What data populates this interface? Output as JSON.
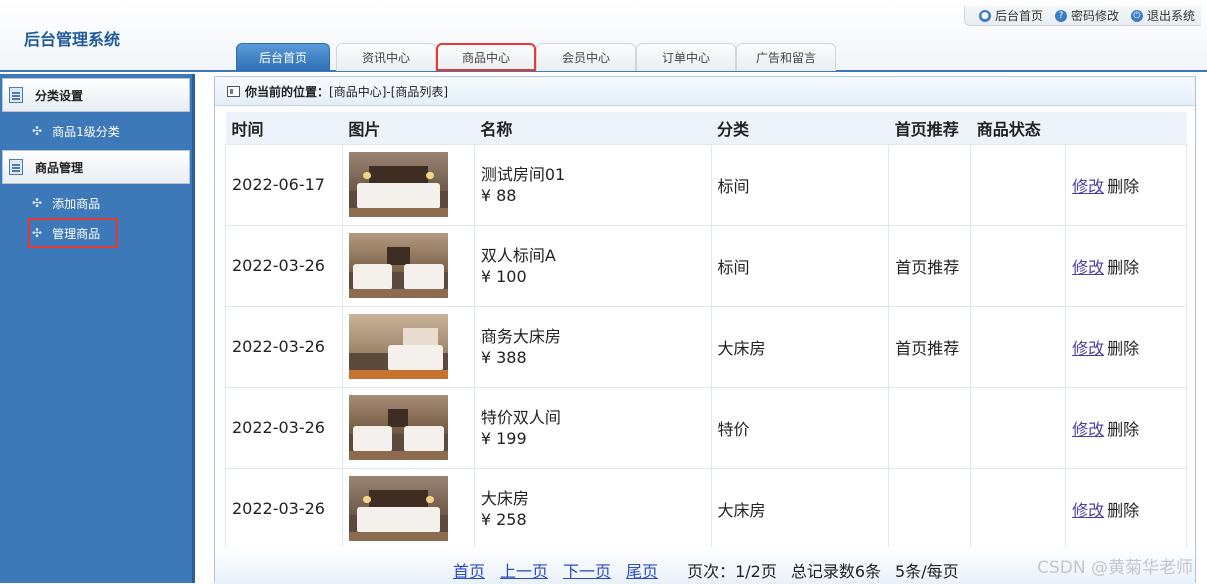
{
  "app": {
    "title": "后台管理系统"
  },
  "top_links": [
    {
      "label": "后台首页",
      "icon": "user-icon"
    },
    {
      "label": "密码修改",
      "icon": "question-icon"
    },
    {
      "label": "退出系统",
      "icon": "power-icon"
    }
  ],
  "tabs": [
    {
      "label": "后台首页",
      "active": true
    },
    {
      "label": "资讯中心"
    },
    {
      "label": "商品中心",
      "highlighted": true
    },
    {
      "label": "会员中心"
    },
    {
      "label": "订单中心"
    },
    {
      "label": "广告和留言"
    }
  ],
  "sidebar": {
    "sections": [
      {
        "title": "分类设置",
        "items": [
          {
            "label": "商品1级分类"
          }
        ]
      },
      {
        "title": "商品管理",
        "items": [
          {
            "label": "添加商品"
          },
          {
            "label": "管理商品",
            "highlighted": true
          }
        ]
      }
    ]
  },
  "breadcrumb": {
    "prefix": "你当前的位置：",
    "path": "[商品中心]-[商品列表]"
  },
  "table": {
    "headers": [
      "时间",
      "图片",
      "名称",
      "分类",
      "首页推荐",
      "商品状态",
      ""
    ],
    "rows": [
      {
        "date": "2022-06-17",
        "name": "测试房间01",
        "price": "¥ 88",
        "category": "标间",
        "recommend": "",
        "status": ""
      },
      {
        "date": "2022-03-26",
        "name": "双人标间A",
        "price": "¥ 100",
        "category": "标间",
        "recommend": "首页推荐",
        "status": ""
      },
      {
        "date": "2022-03-26",
        "name": "商务大床房",
        "price": "¥ 388",
        "category": "大床房",
        "recommend": "首页推荐",
        "status": ""
      },
      {
        "date": "2022-03-26",
        "name": "特价双人间",
        "price": "¥ 199",
        "category": "特价",
        "recommend": "",
        "status": ""
      },
      {
        "date": "2022-03-26",
        "name": "大床房",
        "price": "¥ 258",
        "category": "大床房",
        "recommend": "",
        "status": ""
      }
    ],
    "edit_label": "修改",
    "delete_label": "删除"
  },
  "pager": {
    "first": "首页",
    "prev": "上一页",
    "next": "下一页",
    "last": "尾页",
    "page_info": "页次：1/2页",
    "total_info": "总记录数6条",
    "per_page_info": "5条/每页"
  },
  "watermark": "CSDN @黄菊华老师"
}
